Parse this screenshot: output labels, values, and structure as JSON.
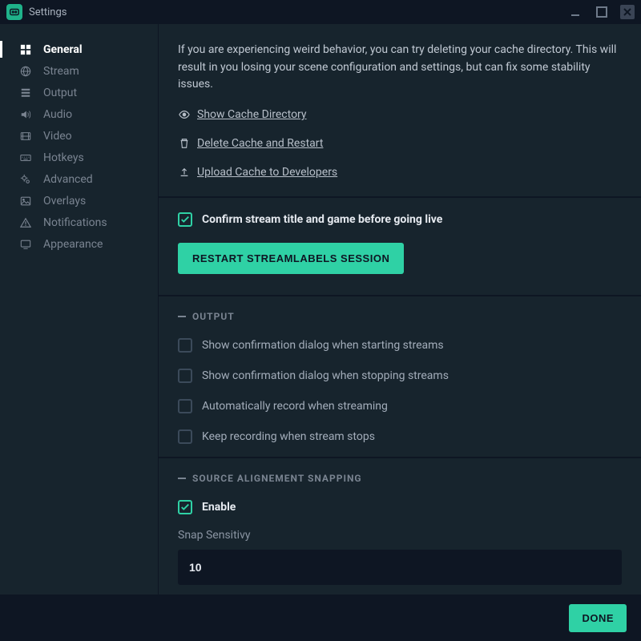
{
  "window": {
    "title": "Settings"
  },
  "sidebar": {
    "items": [
      {
        "label": "General",
        "icon": "grid"
      },
      {
        "label": "Stream",
        "icon": "globe"
      },
      {
        "label": "Output",
        "icon": "stack"
      },
      {
        "label": "Audio",
        "icon": "volume"
      },
      {
        "label": "Video",
        "icon": "film"
      },
      {
        "label": "Hotkeys",
        "icon": "keyboard"
      },
      {
        "label": "Advanced",
        "icon": "cogs"
      },
      {
        "label": "Overlays",
        "icon": "image"
      },
      {
        "label": "Notifications",
        "icon": "warning"
      },
      {
        "label": "Appearance",
        "icon": "monitor"
      }
    ]
  },
  "cache": {
    "info": "If you are experiencing weird behavior, you can try deleting your cache directory. This will result in you losing your scene configuration and settings, but can fix some stability issues.",
    "show": "Show Cache Directory",
    "delete": "Delete Cache and Restart",
    "upload": "Upload Cache to Developers"
  },
  "confirm_stream_label": "Confirm stream title and game before going live",
  "restart_button": "Restart Streamlabels Session",
  "output_section": {
    "title": "OUTPUT",
    "opts": [
      "Show confirmation dialog when starting streams",
      "Show confirmation dialog when stopping streams",
      "Automatically record when streaming",
      "Keep recording when stream stops"
    ]
  },
  "snap_section": {
    "title": "SOURCE ALIGNEMENT SNAPPING",
    "enable": "Enable",
    "sensitivity_label": "Snap Sensitivy",
    "sensitivity_value": "10"
  },
  "footer": {
    "done": "Done"
  }
}
